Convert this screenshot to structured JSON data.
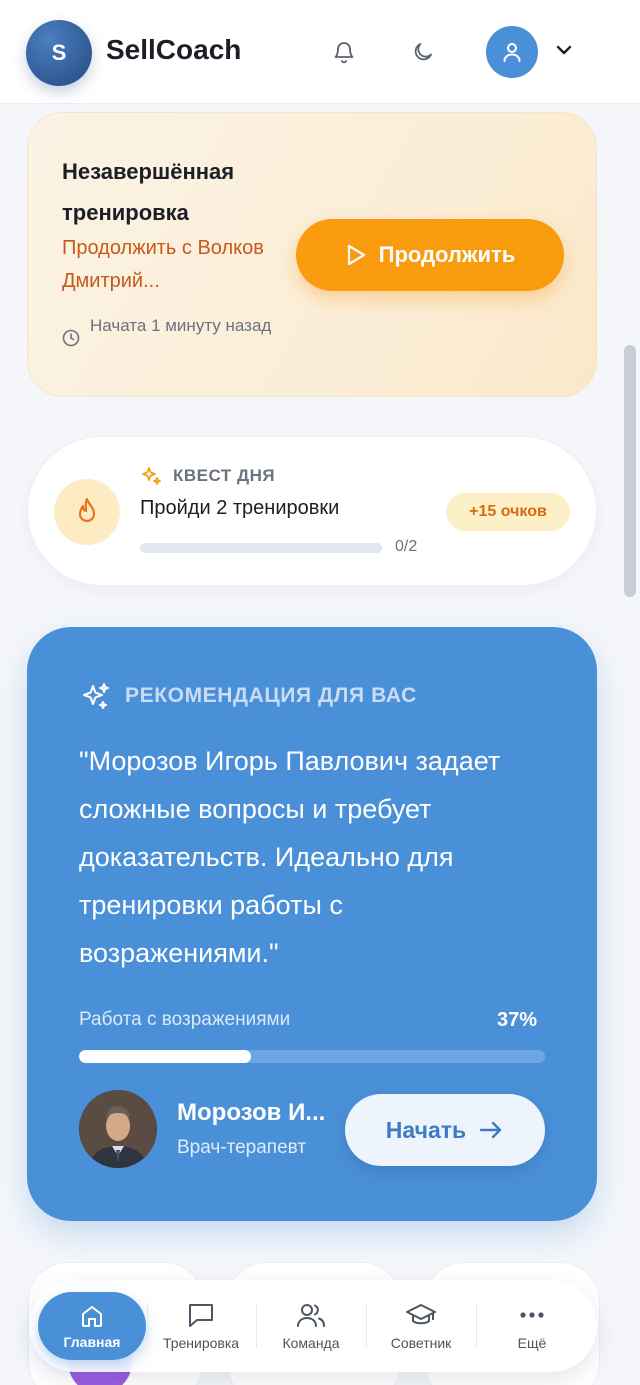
{
  "header": {
    "logo_letter": "S",
    "app_title": "SellCoach",
    "icons": [
      "bell-icon",
      "moon-icon",
      "user-icon",
      "chevron-down-icon"
    ]
  },
  "unfinished": {
    "title": "Незавершённая тренировка",
    "subtitle": "Продолжить с Волков Дмитрий...",
    "started": "Начата 1 минуту назад",
    "button_label": "Продолжить"
  },
  "quest": {
    "label": "КВЕСТ ДНЯ",
    "title": "Пройди 2 тренировки",
    "progress_text": "0/2",
    "progress_fraction": 0,
    "reward": "+15 очков"
  },
  "recommendation": {
    "label": "РЕКОМЕНДАЦИЯ ДЛЯ ВАС",
    "quote": "\"Морозов Игорь Павлович задает сложные вопросы и требует доказательств. Идеально для тренировки работы с возражениями.\"",
    "skill": "Работа с возражениями",
    "skill_percent_text": "37%",
    "skill_percent": 37,
    "persona_name": "Морозов И...",
    "persona_role": "Врач-терапевт",
    "start_label": "Начать"
  },
  "nav": {
    "items": [
      {
        "label": "Главная",
        "icon": "home-icon",
        "active": true
      },
      {
        "label": "Тренировка",
        "icon": "chat-icon",
        "active": false
      },
      {
        "label": "Команда",
        "icon": "users-icon",
        "active": false
      },
      {
        "label": "Советник",
        "icon": "graduation-cap-icon",
        "active": false
      },
      {
        "label": "Ещё",
        "icon": "more-icon",
        "active": false
      }
    ]
  },
  "colors": {
    "accent": "#4a90d9",
    "orange": "#f79c0d",
    "unfinished_sub": "#c8591a"
  }
}
